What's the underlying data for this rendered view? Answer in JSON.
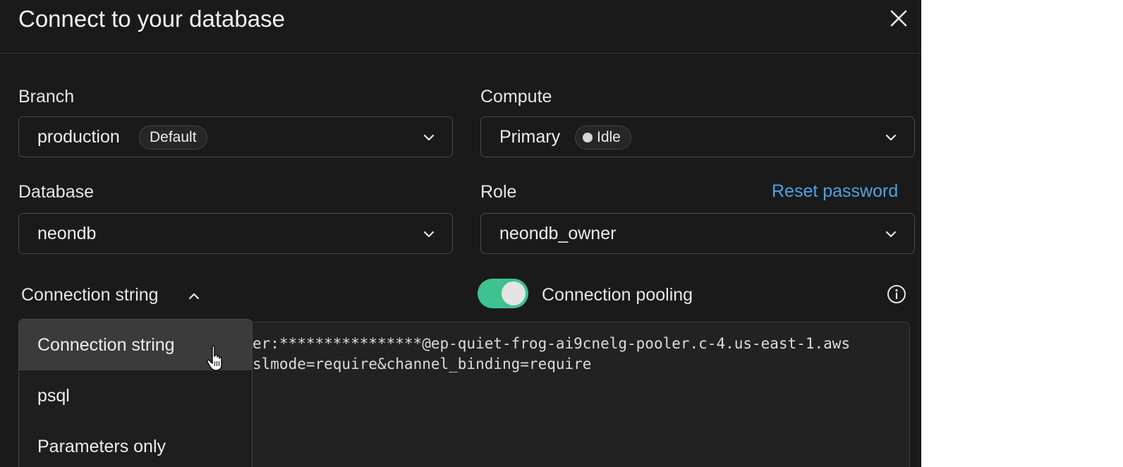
{
  "dialog": {
    "title": "Connect to your database",
    "close_icon": "close-icon"
  },
  "fields": {
    "branch": {
      "label": "Branch",
      "value": "production",
      "badge": "Default"
    },
    "compute": {
      "label": "Compute",
      "value": "Primary",
      "badge": "Idle",
      "status_color": "#d6d6d6"
    },
    "database": {
      "label": "Database",
      "value": "neondb"
    },
    "role": {
      "label": "Role",
      "value": "neondb_owner",
      "action": "Reset password"
    }
  },
  "format": {
    "selected": "Connection string",
    "chevron_icon": "chevron-up-icon",
    "options": [
      "Connection string",
      "psql",
      "Parameters only"
    ],
    "hovered": "Connection string"
  },
  "pooling": {
    "label": "Connection pooling",
    "enabled": true,
    "info_icon": "info-icon"
  },
  "code": {
    "line1": "er:****************@ep-quiet-frog-ai9cnelg-pooler.c-4.us-east-1.aws",
    "line2": "slmode=require&channel_binding=require"
  },
  "colors": {
    "accent_link": "#4aa3e8",
    "toggle_on": "#3ec28f",
    "background": "#1a1a1a"
  }
}
